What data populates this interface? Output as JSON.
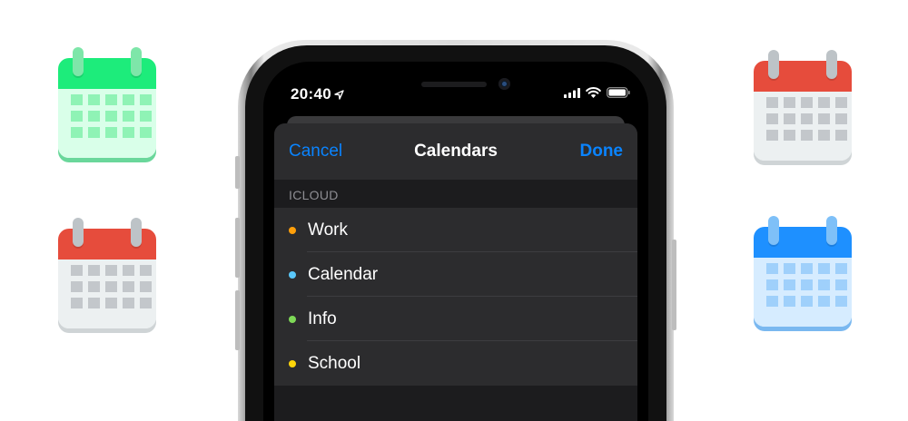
{
  "calendar_icons": [
    {
      "name": "green-calendar-icon",
      "top_color": "#1dec7b",
      "ring_color": "#7ee6a9",
      "body_color": "#d9ffe9",
      "cell_color": "#8ff3b5",
      "shadow": "#6ad79b"
    },
    {
      "name": "red-calendar-icon-left",
      "top_color": "#e64c3c",
      "ring_color": "#bdc3c7",
      "body_color": "#ecf0f1",
      "cell_color": "#c3c7cb",
      "shadow": "#cfd4d6"
    },
    {
      "name": "red-calendar-icon-right",
      "top_color": "#e64c3c",
      "ring_color": "#bdc3c7",
      "body_color": "#ecf0f1",
      "cell_color": "#c3c7cb",
      "shadow": "#cfd4d6"
    },
    {
      "name": "blue-calendar-icon",
      "top_color": "#1e90ff",
      "ring_color": "#7ec0f8",
      "body_color": "#d6ecff",
      "cell_color": "#9fd0fb",
      "shadow": "#7ab8f0"
    }
  ],
  "status_bar": {
    "time": "20:40",
    "icons": [
      "location-arrow-icon",
      "cellular-signal-icon",
      "wifi-icon",
      "battery-icon"
    ]
  },
  "navbar": {
    "cancel_label": "Cancel",
    "title": "Calendars",
    "done_label": "Done"
  },
  "section": {
    "header": "ICLOUD",
    "items": [
      {
        "label": "Work",
        "color": "#ff9f0a"
      },
      {
        "label": "Calendar",
        "color": "#5ac8fa"
      },
      {
        "label": "Info",
        "color": "#7ed957"
      },
      {
        "label": "School",
        "color": "#ffd60a"
      }
    ]
  },
  "colors": {
    "accent": "#0a84ff",
    "sheet_background": "#1c1c1e",
    "row_background": "#2c2c2e"
  }
}
